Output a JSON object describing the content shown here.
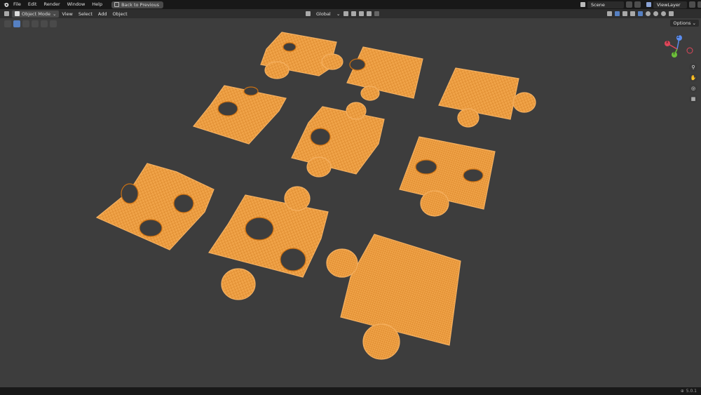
{
  "app": {
    "menu": [
      "File",
      "Edit",
      "Render",
      "Window",
      "Help"
    ],
    "back_label": "Back to Previous",
    "scene": "Scene",
    "view_layer": "ViewLayer"
  },
  "header": {
    "mode": "Object Mode",
    "menus": [
      "View",
      "Select",
      "Add",
      "Object"
    ],
    "transform_orientation": "Global"
  },
  "viewport": {
    "options_label": "Options",
    "axes": {
      "x": "X",
      "y": "Y",
      "z": "Z"
    },
    "mesh_color": "#f08a1c"
  },
  "status": {
    "version": "5.0.1"
  }
}
